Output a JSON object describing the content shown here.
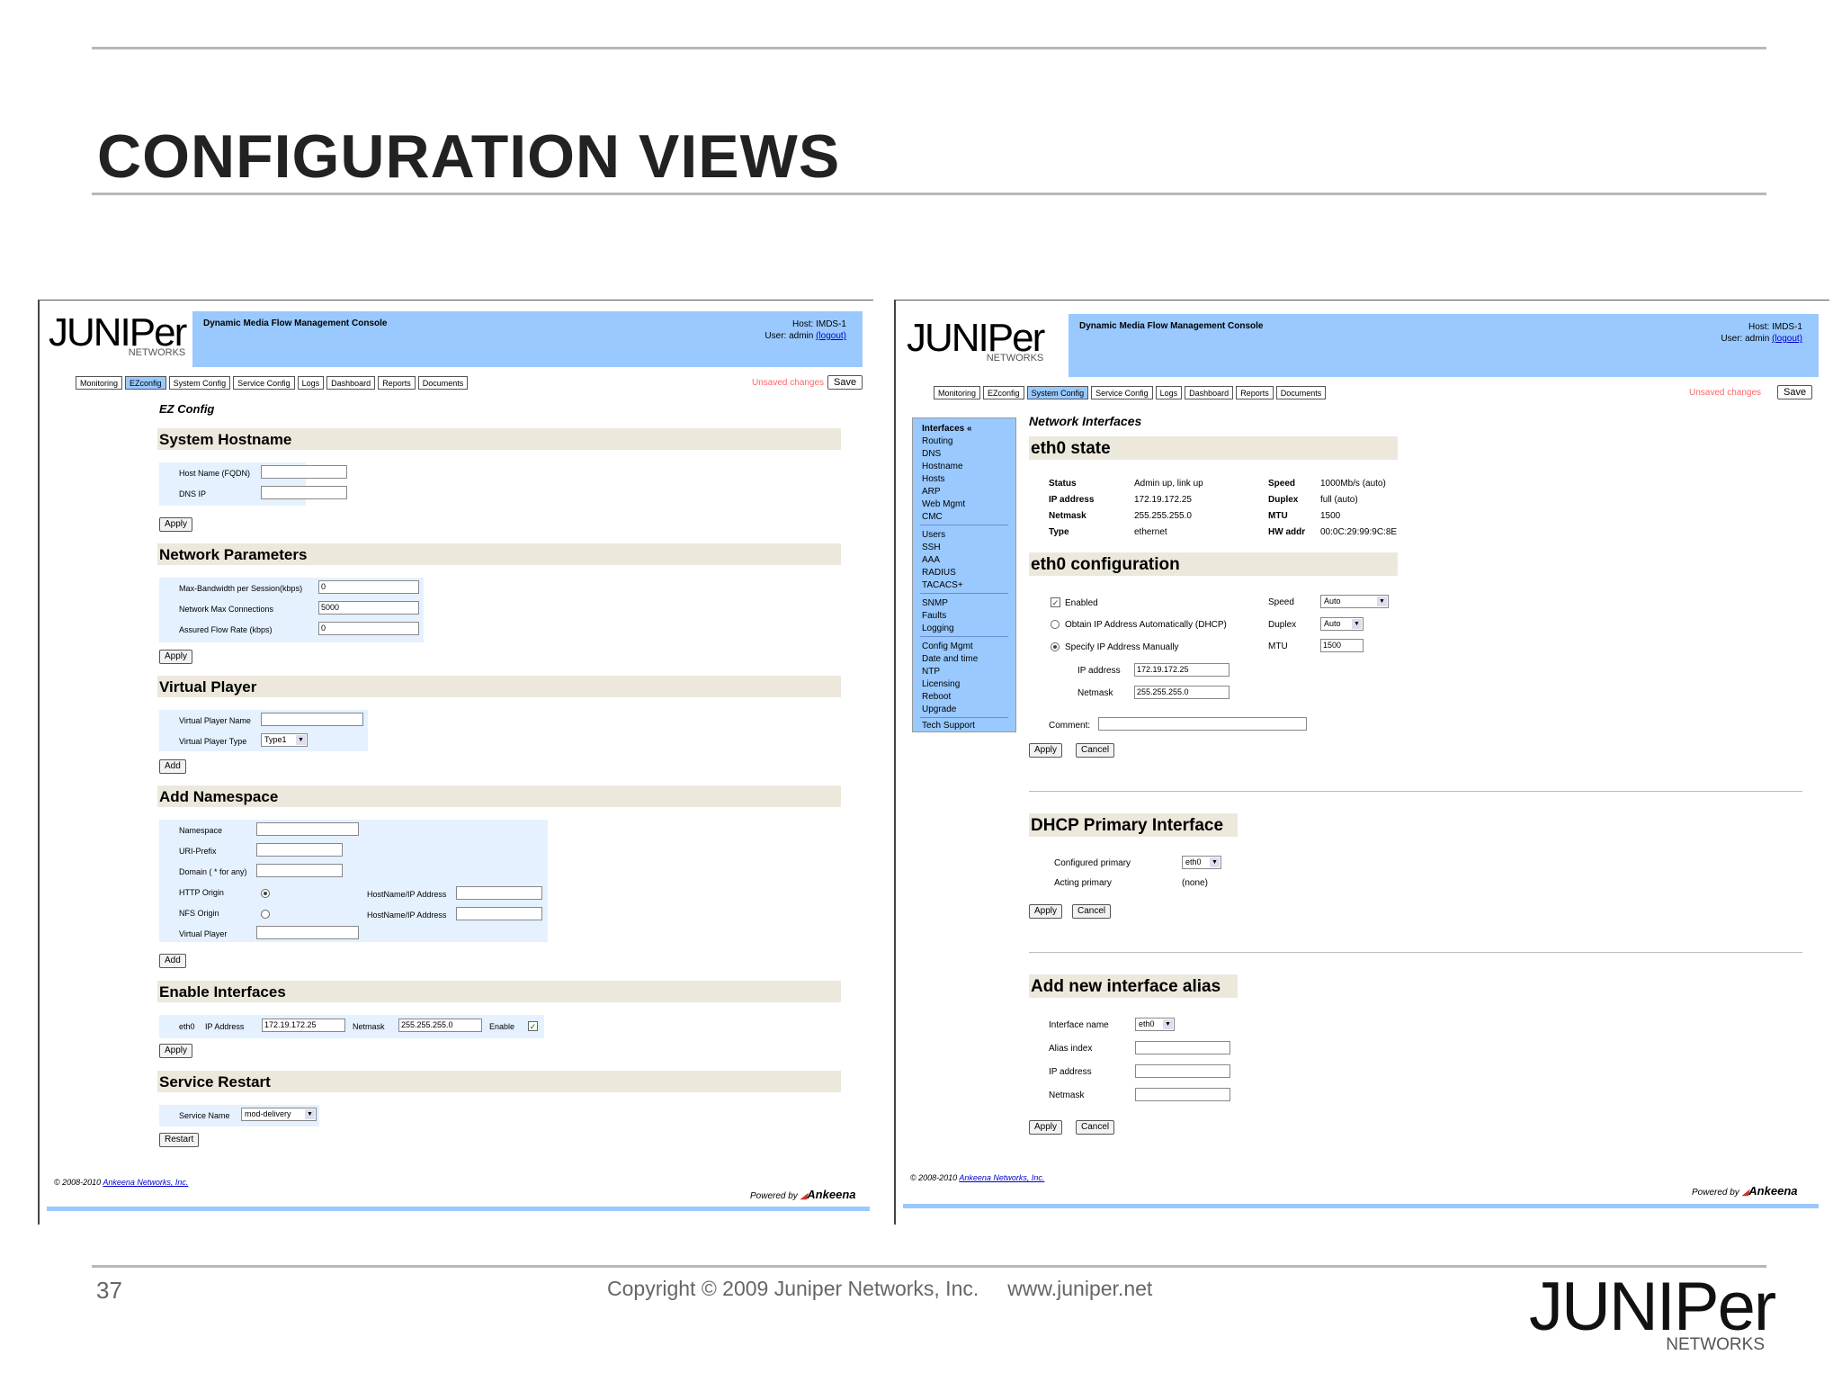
{
  "slide": {
    "title": "CONFIGURATION VIEWS",
    "page_number": "37",
    "copyright": "Copyright © 2009 Juniper Networks, Inc.     www.juniper.net",
    "logo_word": "JUNIPer",
    "logo_sub": "NETWORKS"
  },
  "console": {
    "title": "Dynamic Media Flow Management Console",
    "host": "Host: IMDS-1",
    "user": "User: admin",
    "logout": "(logout)",
    "unsaved": "Unsaved changes",
    "save": "Save",
    "tabs": [
      "Monitoring",
      "EZconfig",
      "System Config",
      "Service Config",
      "Logs",
      "Dashboard",
      "Reports",
      "Documents"
    ],
    "footer_prefix": "© 2008-2010",
    "footer_link": "Ankeena Networks, Inc.",
    "powered_prefix": "Powered by",
    "powered_brand": "Ankeena"
  },
  "ez": {
    "page_title": "EZ Config",
    "hostname": {
      "title": "System Hostname",
      "host_label": "Host Name (FQDN)",
      "dns_label": "DNS IP",
      "apply": "Apply"
    },
    "network": {
      "title": "Network Parameters",
      "bw_label": "Max-Bandwidth per Session(kbps)",
      "bw_value": "0",
      "conn_label": "Network Max Connections",
      "conn_value": "5000",
      "rate_label": "Assured Flow Rate (kbps)",
      "rate_value": "0",
      "apply": "Apply"
    },
    "vplayer": {
      "title": "Virtual Player",
      "name_label": "Virtual Player Name",
      "type_label": "Virtual Player Type",
      "type_value": "Type1",
      "add": "Add"
    },
    "namespace": {
      "title": "Add Namespace",
      "ns_label": "Namespace",
      "uri_label": "URI-Prefix",
      "domain_label": "Domain ( * for any)",
      "http_label": "HTTP Origin",
      "nfs_label": "NFS Origin",
      "vp_label": "Virtual Player",
      "hostip_label": "HostName/IP Address",
      "add": "Add"
    },
    "interfaces": {
      "title": "Enable Interfaces",
      "iface": "eth0",
      "ip_label": "IP Address",
      "ip_value": "172.19.172.25",
      "mask_label": "Netmask",
      "mask_value": "255.255.255.0",
      "enable_label": "Enable",
      "apply": "Apply"
    },
    "restart": {
      "title": "Service Restart",
      "name_label": "Service Name",
      "name_value": "mod-delivery",
      "restart": "Restart"
    }
  },
  "sys": {
    "sidebar": [
      [
        "Interfaces «",
        "Routing",
        "DNS",
        "Hostname",
        "Hosts",
        "ARP",
        "Web Mgmt",
        "CMC"
      ],
      [
        "Users",
        "SSH",
        "AAA",
        "RADIUS",
        "TACACS+"
      ],
      [
        "SNMP",
        "Faults",
        "Logging"
      ],
      [
        "Config Mgmt",
        "Date and time",
        "NTP",
        "Licensing",
        "Reboot",
        "Upgrade"
      ],
      [
        "Tech Support"
      ]
    ],
    "page_title": "Network Interfaces",
    "state": {
      "title": "eth0 state",
      "status_label": "Status",
      "status_value": "Admin up, link up",
      "ip_label": "IP address",
      "ip_value": "172.19.172.25",
      "mask_label": "Netmask",
      "mask_value": "255.255.255.0",
      "type_label": "Type",
      "type_value": "ethernet",
      "speed_label": "Speed",
      "speed_value": "1000Mb/s (auto)",
      "duplex_label": "Duplex",
      "duplex_value": "full (auto)",
      "mtu_label": "MTU",
      "mtu_value": "1500",
      "hw_label": "HW addr",
      "hw_value": "00:0C:29:99:9C:8E"
    },
    "config": {
      "title": "eth0 configuration",
      "enabled": "Enabled",
      "dhcp": "Obtain IP Address Automatically (DHCP)",
      "manual": "Specify IP Address Manually",
      "ip_label": "IP address",
      "ip_value": "172.19.172.25",
      "mask_label": "Netmask",
      "mask_value": "255.255.255.0",
      "speed_label": "Speed",
      "speed_value": "Auto",
      "duplex_label": "Duplex",
      "duplex_value": "Auto",
      "mtu_label": "MTU",
      "mtu_value": "1500",
      "comment_label": "Comment:",
      "apply": "Apply",
      "cancel": "Cancel"
    },
    "dhcp": {
      "title": "DHCP Primary Interface",
      "configured_label": "Configured primary",
      "configured_value": "eth0",
      "acting_label": "Acting primary",
      "acting_value": "(none)",
      "apply": "Apply",
      "cancel": "Cancel"
    },
    "alias": {
      "title": "Add new interface alias",
      "name_label": "Interface name",
      "name_value": "eth0",
      "index_label": "Alias index",
      "ip_label": "IP address",
      "mask_label": "Netmask",
      "apply": "Apply",
      "cancel": "Cancel"
    }
  }
}
